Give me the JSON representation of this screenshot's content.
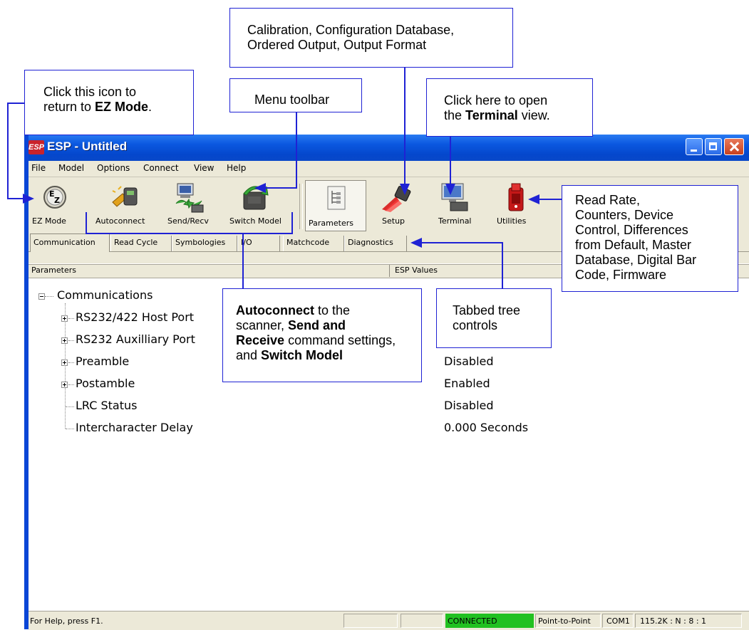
{
  "window": {
    "app_icon": "ESP",
    "title_app": "ESP",
    "title_sep": " - ",
    "title_doc": "Untitled"
  },
  "menu": [
    "File",
    "Model",
    "Options",
    "Connect",
    "View",
    "Help"
  ],
  "toolbar": [
    {
      "label": "EZ Mode",
      "icon": "ez-mode-icon"
    },
    {
      "label": "Autoconnect",
      "icon": "autoconnect-icon"
    },
    {
      "label": "Send/Recv",
      "icon": "send-recv-icon"
    },
    {
      "label": "Switch Model",
      "icon": "switch-model-icon"
    },
    {
      "label": "Parameters",
      "icon": "parameters-icon",
      "selected": true
    },
    {
      "label": "Setup",
      "icon": "setup-icon"
    },
    {
      "label": "Terminal",
      "icon": "terminal-icon"
    },
    {
      "label": "Utilities",
      "icon": "utilities-icon"
    }
  ],
  "tabs": [
    "Communication",
    "Read Cycle",
    "Symbologies",
    "I/O",
    "Matchcode",
    "Diagnostics"
  ],
  "active_tab": "Communication",
  "columns": {
    "parameters": "Parameters",
    "values": "ESP Values"
  },
  "tree": {
    "root": "Communications",
    "rows": [
      {
        "label": "RS232/422 Host Port",
        "value": ""
      },
      {
        "label": "RS232 Auxilliary Port",
        "value": ""
      },
      {
        "label": "Preamble",
        "value": "Disabled"
      },
      {
        "label": "Postamble",
        "value": "Enabled"
      },
      {
        "label": "LRC Status",
        "value": "Disabled"
      },
      {
        "label": "Intercharacter Delay",
        "value": "0.000 Seconds"
      }
    ]
  },
  "statusbar": {
    "help": "For Help, press F1.",
    "connection": "CONNECTED",
    "mode": "Point-to-Point",
    "port": "COM1",
    "settings": "115.2K : N : 8 : 1"
  },
  "callouts": {
    "ez_mode": {
      "l1": "Click this icon to",
      "l2a": "return to ",
      "l2b": "EZ Mode",
      "l2c": "."
    },
    "menu_toolbar": "Menu toolbar",
    "setup": {
      "l1": "Calibration, Configuration Database,",
      "l2": "Ordered Output, Output Format"
    },
    "terminal": {
      "l1": "Click here to open",
      "l2a": "the ",
      "l2b": "Terminal",
      "l2c": " view."
    },
    "utilities": [
      "Read Rate,",
      "Counters, Device",
      "Control, Differences",
      "from Default, Master",
      "Database, Digital Bar",
      "Code, Firmware"
    ],
    "autoconnect": {
      "l1a": "Autoconnect",
      "l1b": " to the",
      "l2a": "scanner, ",
      "l2b": "Send and",
      "l3a": "Receive",
      "l3b": " command settings,",
      "l4a": "and ",
      "l4b": "Switch Model"
    },
    "tabbed": [
      "Tabbed tree",
      "controls"
    ]
  },
  "colors": {
    "callout_blue": "#1f22d4",
    "title_blue": "#0b58e0",
    "connected_green": "#21c121",
    "window_face": "#ece9d8"
  }
}
